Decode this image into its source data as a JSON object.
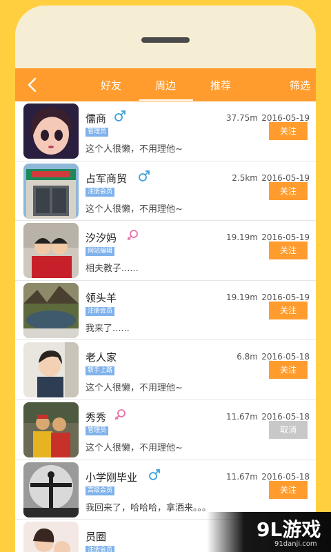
{
  "nav": {
    "back_icon": "chevron-left-icon",
    "tabs": [
      {
        "label": "好友",
        "active": false
      },
      {
        "label": "周边",
        "active": true
      },
      {
        "label": "推荐",
        "active": false
      }
    ],
    "filter_label": "筛选"
  },
  "colors": {
    "accent": "#ff9c2d",
    "background": "#ffcf40",
    "badge": "#7fb2ec",
    "male": "#3aa0d8",
    "female": "#ec6fa8"
  },
  "users": [
    {
      "name": "儒商",
      "gender": "male",
      "badge": "管理员",
      "signature": "这个人很懒，不用理他~",
      "distance": "37.75m",
      "date": "2016-05-19",
      "action": "关注"
    },
    {
      "name": "占军商贸",
      "gender": "male",
      "badge": "注册会员",
      "signature": "这个人很懒，不用理他~",
      "distance": "2.5km",
      "date": "2016-05-19",
      "action": "关注"
    },
    {
      "name": "汐汐妈",
      "gender": "female",
      "badge": "网站编辑",
      "signature": "相夫教子......",
      "distance": "19.19m",
      "date": "2016-05-19",
      "action": "关注"
    },
    {
      "name": "领头羊",
      "gender": "",
      "badge": "注册会员",
      "signature": "我来了......",
      "distance": "19.19m",
      "date": "2016-05-19",
      "action": "关注"
    },
    {
      "name": "老人家",
      "gender": "",
      "badge": "新手上路",
      "signature": "这个人很懒，不用理他~",
      "distance": "6.8m",
      "date": "2016-05-18",
      "action": "关注"
    },
    {
      "name": "秀秀",
      "gender": "female",
      "badge": "管理员",
      "signature": "这个人很懒，不用理他~",
      "distance": "11.67m",
      "date": "2016-05-18",
      "action": "取消"
    },
    {
      "name": "小学刚毕业",
      "gender": "male",
      "badge": "高级会员",
      "signature": "我回来了，哈哈哈，拿酒来。。。",
      "distance": "11.67m",
      "date": "2016-05-18",
      "action": "关注"
    },
    {
      "name": "员圈",
      "gender": "",
      "badge": "注册会员",
      "signature": "",
      "distance": "",
      "date": "",
      "action": ""
    }
  ],
  "watermark": {
    "logo": "9L游戏",
    "url": "91danji.com"
  }
}
